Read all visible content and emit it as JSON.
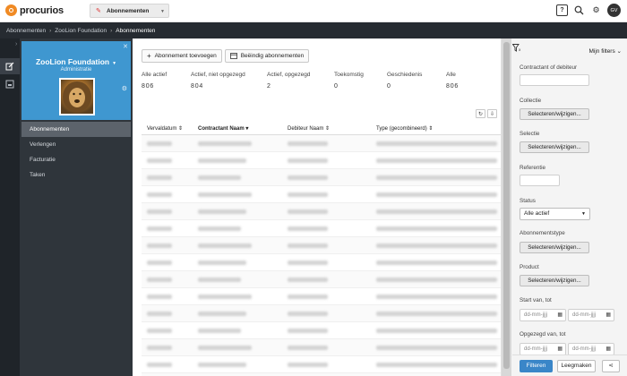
{
  "app": {
    "logo_text": "procurios"
  },
  "topbar": {
    "module_label": "Abonnementen",
    "icons": [
      "help-icon",
      "search-icon",
      "settings-icon"
    ],
    "help_glyph": "?",
    "avatar_initials": "GV"
  },
  "breadcrumb": [
    "Abonnementen",
    "ZooLion Foundation",
    "Abonnementen"
  ],
  "sidebar": {
    "org_name": "ZooLion Foundation",
    "org_subtitle": "Administratie",
    "items": [
      {
        "label": "Abonnementen",
        "active": true
      },
      {
        "label": "Verlengen",
        "active": false
      },
      {
        "label": "Facturatie",
        "active": false
      },
      {
        "label": "Taken",
        "active": false
      }
    ]
  },
  "actions": {
    "add_label": "Abonnement toevoegen",
    "end_label": "Beëindig abonnementen"
  },
  "stats": [
    {
      "label": "Alle actief",
      "value": "806"
    },
    {
      "label": "Actief, niet opgezegd",
      "value": "804"
    },
    {
      "label": "Actief, opgezegd",
      "value": "2"
    },
    {
      "label": "Toekomstig",
      "value": "0"
    },
    {
      "label": "Geschiedenis",
      "value": "0"
    },
    {
      "label": "Alle",
      "value": "806"
    }
  ],
  "table": {
    "columns": [
      "Vervaldatum",
      "Contractant Naam",
      "Debiteur Naam",
      "Type (gecombineerd)"
    ],
    "row_count": 15
  },
  "filters": {
    "my_filters_label": "Mijn filters",
    "contractant_label": "Contractant of debiteur",
    "collectie_label": "Collectie",
    "collectie_button": "Selecteren/wijzigen...",
    "selectie_label": "Selectie",
    "selectie_button": "Selecteren/wijzigen...",
    "referentie_label": "Referentie",
    "status_label": "Status",
    "status_value": "Alle actief",
    "abonnementstype_label": "Abonnementstype",
    "abonnementstype_button": "Selecteren/wijzigen...",
    "product_label": "Product",
    "product_button": "Selecteren/wijzigen...",
    "start_label": "Start van, tot",
    "opgezegd_label": "Opgezegd van, tot",
    "date_placeholder": "dd-mm-jjjj",
    "apply_label": "Filteren",
    "clear_label": "Leegmaken"
  }
}
